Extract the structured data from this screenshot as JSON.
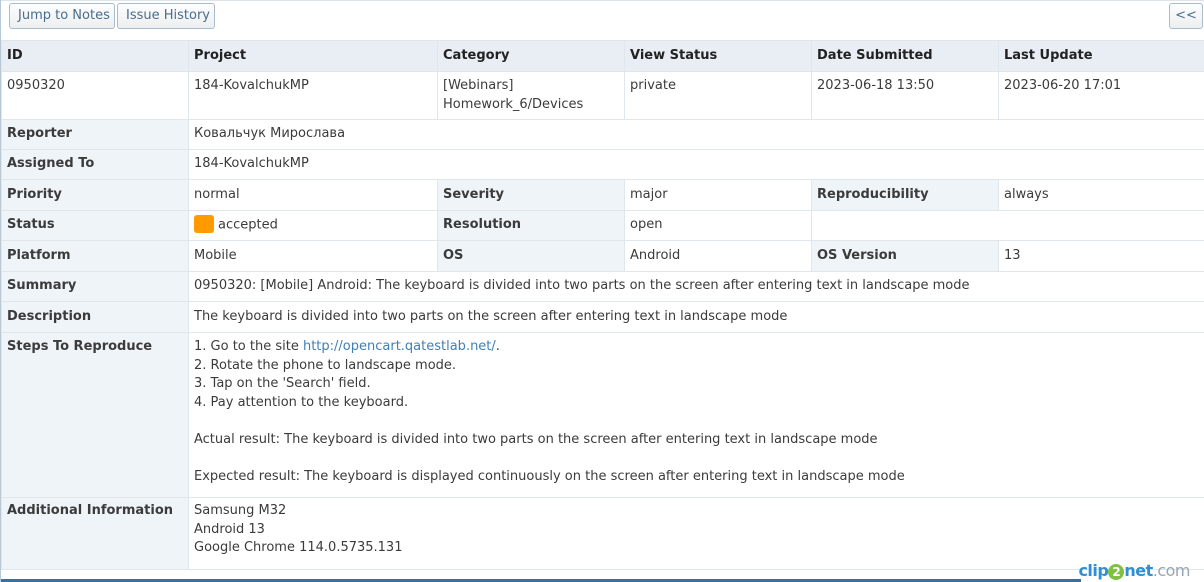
{
  "toolbar": {
    "jump_to_notes": "Jump to Notes",
    "issue_history": "Issue History",
    "collapse": "<<"
  },
  "header": {
    "id": "ID",
    "project": "Project",
    "category": "Category",
    "view_status": "View Status",
    "date_submitted": "Date Submitted",
    "last_update": "Last Update"
  },
  "issue": {
    "id": "0950320",
    "project": "184-KovalchukMP",
    "category_line1": "[Webinars]",
    "category_line2": "Homework_6/Devices",
    "view_status": "private",
    "date_submitted": "2023-06-18 13:50",
    "last_update": "2023-06-20 17:01"
  },
  "fields": {
    "reporter_label": "Reporter",
    "reporter": "Ковальчук Мирослава",
    "assigned_label": "Assigned To",
    "assigned": "184-KovalchukMP",
    "priority_label": "Priority",
    "priority": "normal",
    "severity_label": "Severity",
    "severity": "major",
    "reproducibility_label": "Reproducibility",
    "reproducibility": "always",
    "status_label": "Status",
    "status": "accepted",
    "status_color": "#ff9a00",
    "resolution_label": "Resolution",
    "resolution": "open",
    "platform_label": "Platform",
    "platform": "Mobile",
    "os_label": "OS",
    "os": "Android",
    "os_version_label": "OS Version",
    "os_version": "13",
    "summary_label": "Summary",
    "summary": "0950320: [Mobile] Android: The keyboard is divided into two parts on the screen after entering text in landscape mode",
    "description_label": "Description",
    "description": "The keyboard is divided into two parts on the screen after entering text in landscape mode"
  },
  "steps": {
    "label": "Steps To Reproduce",
    "step1_prefix": "1. Go to the site ",
    "step1_link": "http://opencart.qatestlab.net/",
    "step1_suffix": ".",
    "step2": "2. Rotate the phone to landscape mode.",
    "step3": "3. Tap on the 'Search' field.",
    "step4": "4. Pay attention to the keyboard.",
    "actual": "Actual result: The keyboard is divided into two parts on the screen after entering text in landscape mode",
    "expected": "Expected result: The keyboard is displayed continuously on the screen after entering text in landscape mode"
  },
  "additional": {
    "label": "Additional Information",
    "line1": "Samsung M32",
    "line2": "Android 13",
    "line3": "Google Chrome 114.0.5735.131"
  },
  "watermark": {
    "left": "clip",
    "mid": "2",
    "right": "net",
    "domain": ".com"
  }
}
